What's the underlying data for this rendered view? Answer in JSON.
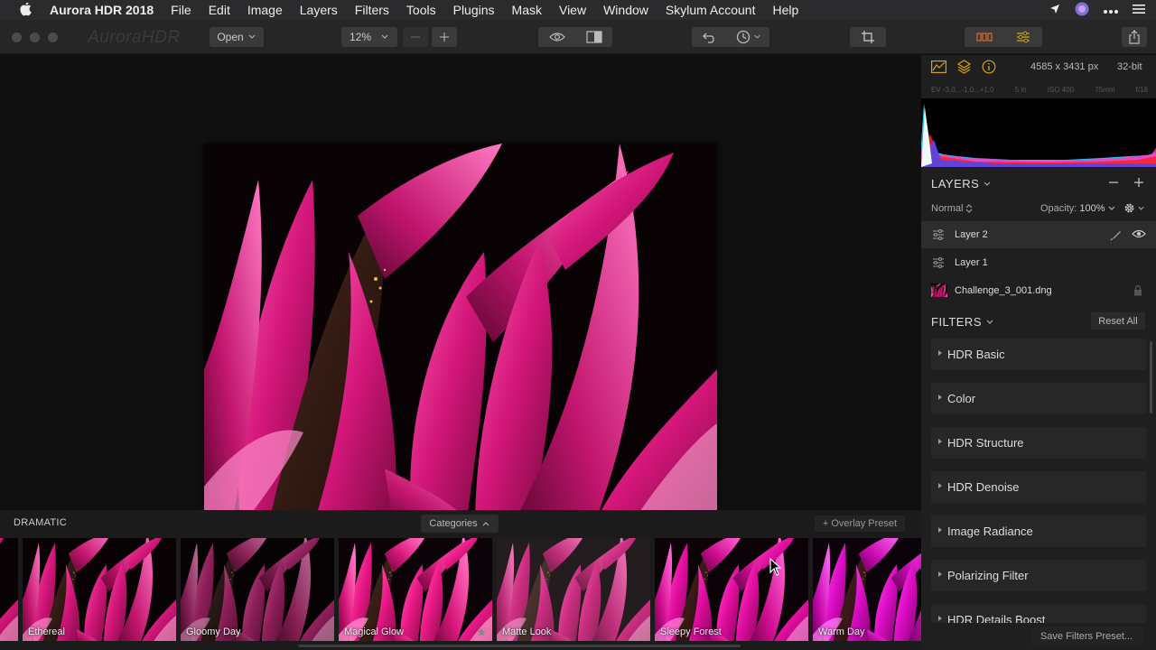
{
  "menubar": {
    "app_name": "Aurora HDR 2018",
    "items": [
      "File",
      "Edit",
      "Image",
      "Layers",
      "Filters",
      "Tools",
      "Plugins",
      "Mask",
      "View",
      "Window",
      "Skylum Account",
      "Help"
    ]
  },
  "toolbar": {
    "logo": "AuroraHDR",
    "open_label": "Open",
    "zoom_value": "12%"
  },
  "image_info": {
    "dimensions": "4585 x 3431 px",
    "bit_depth": "32-bit",
    "exif": [
      "EV -3.0...-1.0...+1.0",
      "5 in",
      "ISO 400",
      "75mm",
      "f/18"
    ]
  },
  "layers": {
    "title": "LAYERS",
    "blend_mode": "Normal",
    "opacity_label": "Opacity:",
    "opacity_value": "100%",
    "items": [
      {
        "name": "Layer 2",
        "selected": true
      },
      {
        "name": "Layer 1",
        "selected": false
      },
      {
        "name": "Challenge_3_001.dng",
        "selected": false
      }
    ]
  },
  "filters": {
    "title": "FILTERS",
    "reset_label": "Reset All",
    "items": [
      "HDR Basic",
      "Color",
      "HDR Structure",
      "HDR Denoise",
      "Image Radiance",
      "Polarizing Filter",
      "HDR Details Boost"
    ],
    "save_label": "Save Filters Preset..."
  },
  "presets": {
    "category": "DRAMATIC",
    "categories_label": "Categories",
    "overlay_label": "+ Overlay Preset",
    "items": [
      "Ethereal",
      "Gloomy Day",
      "Magical Glow",
      "Matte Look",
      "Sleepy Forest",
      "Warm Day"
    ]
  },
  "colors": {
    "accent": "#d4a017",
    "menubar_bg": "#2b2b2d",
    "panel_bg": "#1f1f1f"
  }
}
